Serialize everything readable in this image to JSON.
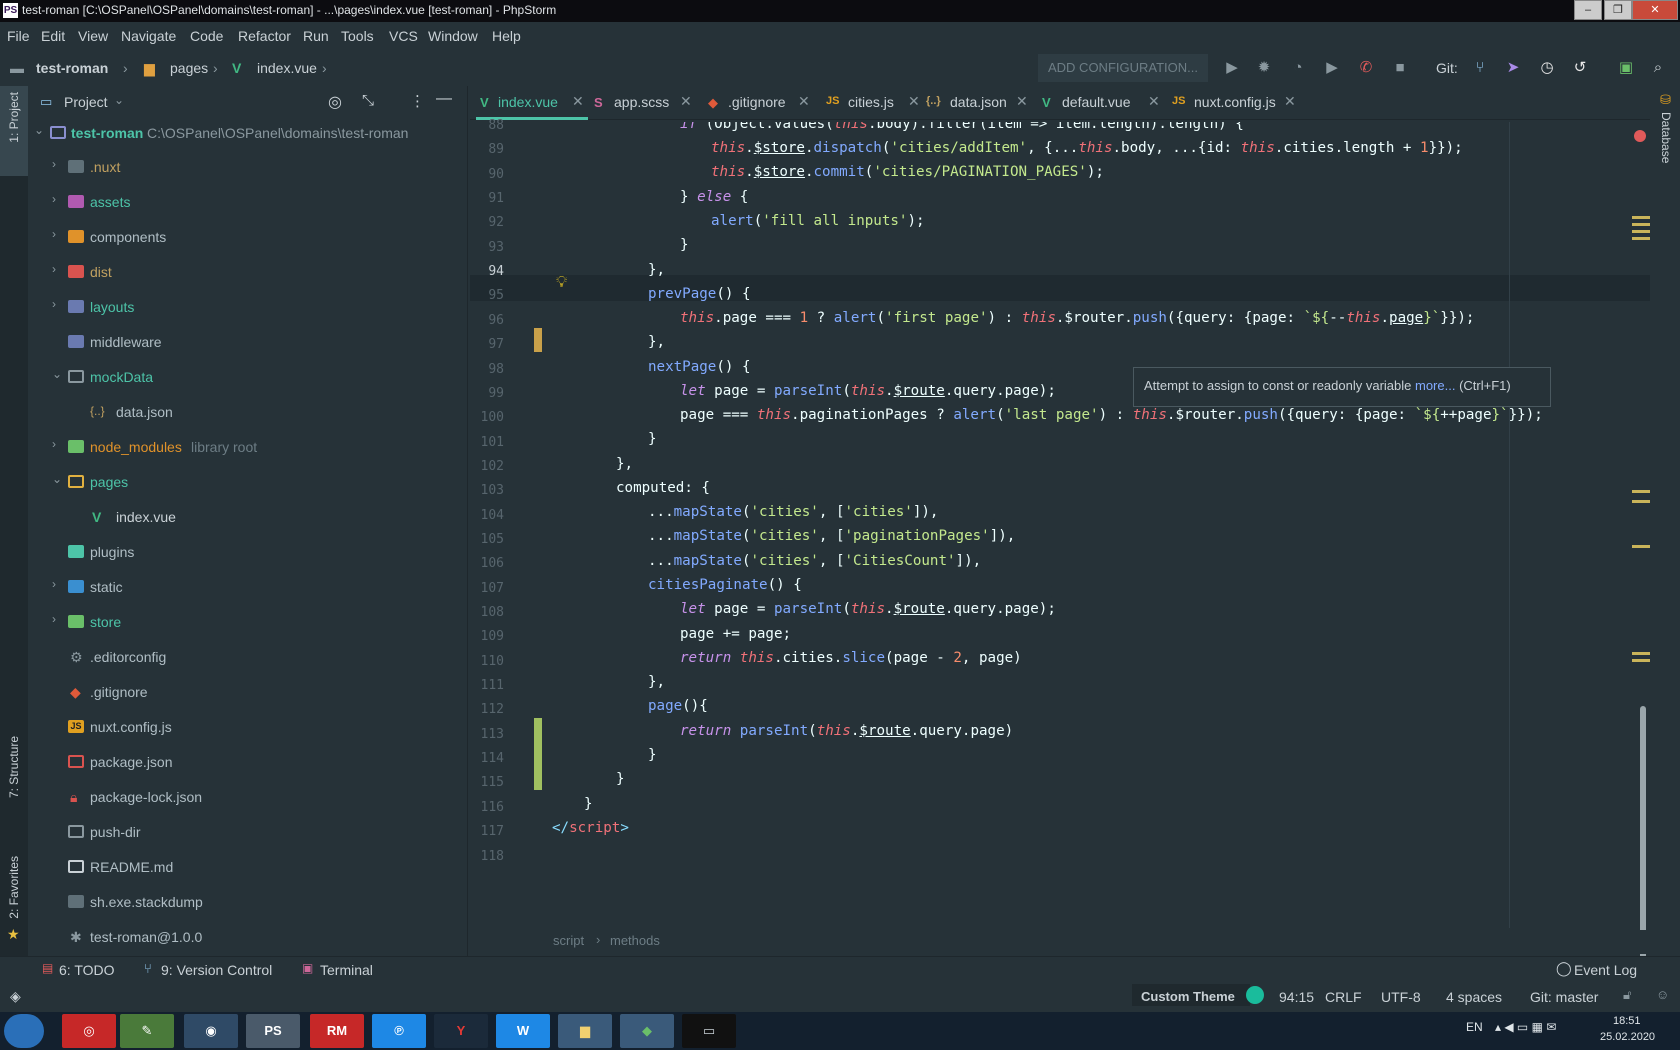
{
  "window": {
    "title": "test-roman [C:\\OSPanel\\OSPanel\\domains\\test-roman] - ...\\pages\\index.vue [test-roman] - PhpStorm",
    "app_badge": "PS"
  },
  "menu": [
    "File",
    "Edit",
    "View",
    "Navigate",
    "Code",
    "Refactor",
    "Run",
    "Tools",
    "VCS",
    "Window",
    "Help"
  ],
  "breadcrumb": {
    "project": "test-roman",
    "folder": "pages",
    "file": "index.vue"
  },
  "toolbar": {
    "config": "ADD CONFIGURATION...",
    "git_label": "Git:"
  },
  "left_strip": {
    "project": "1: Project",
    "structure": "7: Structure",
    "favorites": "2: Favorites"
  },
  "right_strip": {
    "database": "Database"
  },
  "project_panel": {
    "title": "Project",
    "root": {
      "name": "test-roman",
      "path": "C:\\OSPanel\\OSPanel\\domains\\test-roman"
    },
    "items": [
      {
        "name": ".nuxt",
        "extra": ""
      },
      {
        "name": "assets",
        "extra": ""
      },
      {
        "name": "components",
        "extra": ""
      },
      {
        "name": "dist",
        "extra": ""
      },
      {
        "name": "layouts",
        "extra": ""
      },
      {
        "name": "middleware",
        "extra": ""
      },
      {
        "name": "mockData",
        "extra": ""
      },
      {
        "name": "data.json",
        "extra": ""
      },
      {
        "name": "node_modules",
        "extra": "library root"
      },
      {
        "name": "pages",
        "extra": ""
      },
      {
        "name": "index.vue",
        "extra": ""
      },
      {
        "name": "plugins",
        "extra": ""
      },
      {
        "name": "static",
        "extra": ""
      },
      {
        "name": "store",
        "extra": ""
      },
      {
        "name": ".editorconfig",
        "extra": ""
      },
      {
        "name": ".gitignore",
        "extra": ""
      },
      {
        "name": "nuxt.config.js",
        "extra": ""
      },
      {
        "name": "package.json",
        "extra": ""
      },
      {
        "name": "package-lock.json",
        "extra": ""
      },
      {
        "name": "push-dir",
        "extra": ""
      },
      {
        "name": "README.md",
        "extra": ""
      },
      {
        "name": "sh.exe.stackdump",
        "extra": ""
      },
      {
        "name": "test-roman@1.0.0",
        "extra": ""
      }
    ]
  },
  "tabs": [
    {
      "label": "index.vue",
      "icon": "V"
    },
    {
      "label": "app.scss",
      "icon": "S"
    },
    {
      "label": ".gitignore",
      "icon": "◆"
    },
    {
      "label": "cities.js",
      "icon": "JS"
    },
    {
      "label": "data.json",
      "icon": "{..}"
    },
    {
      "label": "default.vue",
      "icon": "V"
    },
    {
      "label": "nuxt.config.js",
      "icon": "JS"
    }
  ],
  "line_numbers": [
    "88",
    "89",
    "90",
    "91",
    "92",
    "93",
    "94",
    "95",
    "96",
    "97",
    "98",
    "99",
    "100",
    "101",
    "102",
    "103",
    "104",
    "105",
    "106",
    "107",
    "108",
    "109",
    "110",
    "111",
    "112",
    "113",
    "114",
    "115",
    "116",
    "117",
    "118"
  ],
  "tooltip": {
    "text": "Attempt to assign to const or readonly variable",
    "link": "more...",
    "shortcut": "(Ctrl+F1)"
  },
  "editor_breadcrumb": {
    "a": "script",
    "b": "methods"
  },
  "tool_windows": {
    "todo": "6: TODO",
    "vcs": "9: Version Control",
    "terminal": "Terminal",
    "event_log": "Event Log"
  },
  "status": {
    "theme": "Custom Theme",
    "position": "94:15",
    "line_sep": "CRLF",
    "encoding": "UTF-8",
    "indent": "4 spaces",
    "git": "Git: master"
  },
  "taskbar": {
    "lang": "EN",
    "time": "18:51",
    "date": "25.02.2020",
    "apps": [
      "",
      "",
      "",
      "",
      "PS",
      "RM",
      "",
      "Y",
      "W",
      "",
      "",
      ""
    ]
  },
  "colors": {
    "bg": "#263238",
    "keyword": "#c792ea",
    "this": "#f07178",
    "string": "#c3e88d",
    "function": "#82aaff",
    "number": "#f78c6c",
    "folder": "#7f6bb3"
  }
}
